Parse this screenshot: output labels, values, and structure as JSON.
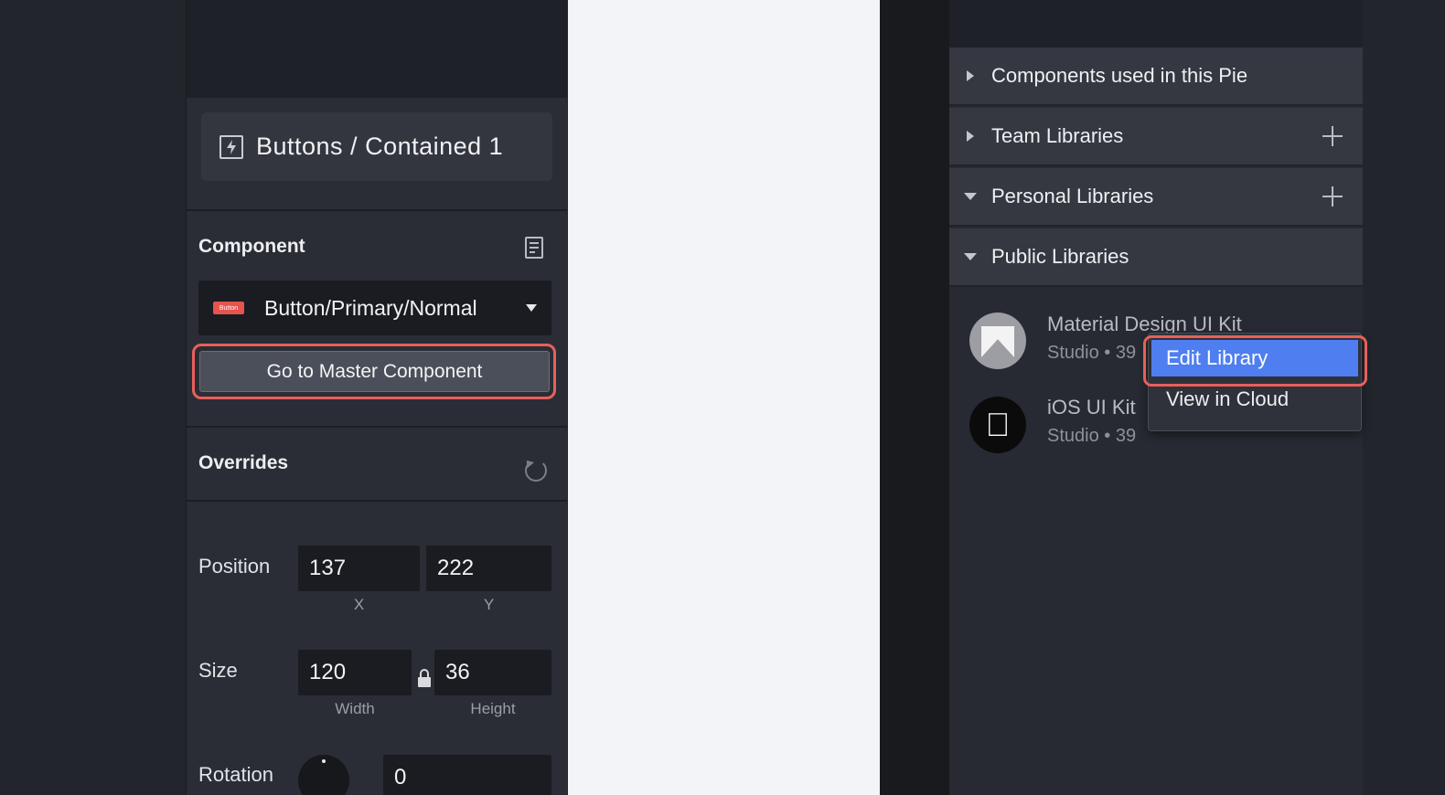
{
  "left_panel": {
    "symbol_title": "Buttons / Contained 1",
    "component": {
      "section_title": "Component",
      "selected_value": "Button/Primary/Normal",
      "thumb_text": "Button",
      "master_button_label": "Go to Master Component"
    },
    "overrides": {
      "section_title": "Overrides"
    },
    "position": {
      "label": "Position",
      "x_value": "137",
      "y_value": "222",
      "x_caption": "X",
      "y_caption": "Y"
    },
    "size": {
      "label": "Size",
      "width_value": "120",
      "height_value": "36",
      "width_caption": "Width",
      "height_caption": "Height"
    },
    "rotation": {
      "label": "Rotation",
      "value": "0"
    }
  },
  "right_panel": {
    "rows": [
      {
        "label": "Components used in this Pie",
        "expanded": false,
        "has_add": false
      },
      {
        "label": "Team Libraries",
        "expanded": false,
        "has_add": true
      },
      {
        "label": "Personal Libraries",
        "expanded": true,
        "has_add": true
      },
      {
        "label": "Public Libraries",
        "expanded": true,
        "has_add": false
      }
    ],
    "kits": [
      {
        "name": "Material Design UI Kit",
        "meta": "Studio • 39",
        "icon": "material-logo-icon"
      },
      {
        "name": "iOS UI Kit",
        "meta": "Studio • 39",
        "icon": "apple-logo-icon"
      }
    ]
  },
  "context_menu": {
    "items": [
      "Edit Library",
      "View in Cloud"
    ],
    "active_item": "Edit Library"
  },
  "colors": {
    "accent_blue": "#4f7ef0",
    "highlight_red": "#e8605b",
    "panel_dark": "#2a2d35",
    "canvas_bg": "#f3f4f7"
  }
}
